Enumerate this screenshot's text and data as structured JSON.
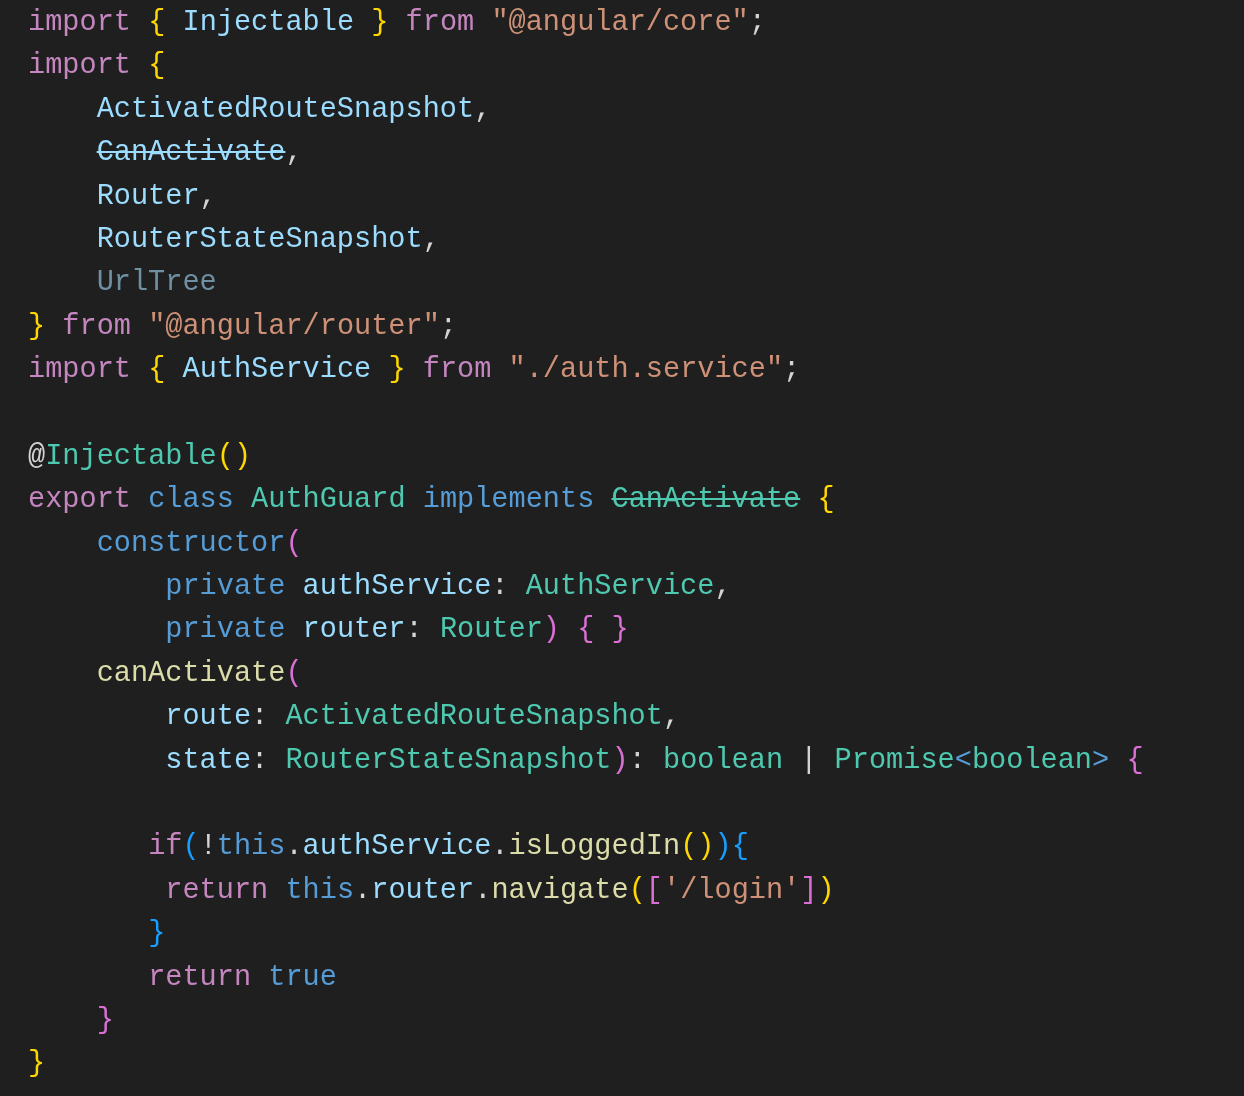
{
  "editor": {
    "lines": [
      {
        "kind": "code",
        "tokens": [
          {
            "text": "import",
            "kind": "keyword"
          },
          {
            "text": " {",
            "kind": "brace1"
          },
          {
            "text": " Injectable ",
            "kind": "variable"
          },
          {
            "text": "}",
            "kind": "brace1"
          },
          {
            "text": " from ",
            "kind": "keyword"
          },
          {
            "text": "\"@angular/core\"",
            "kind": "string"
          },
          {
            "text": ";",
            "kind": "plain"
          }
        ]
      },
      {
        "kind": "code",
        "tokens": [
          {
            "text": "import",
            "kind": "keyword"
          },
          {
            "text": " {",
            "kind": "brace1"
          }
        ]
      },
      {
        "kind": "code",
        "tokens": [
          {
            "text": "    ActivatedRouteSnapshot",
            "kind": "variable"
          },
          {
            "text": ",",
            "kind": "plain"
          }
        ]
      },
      {
        "kind": "code",
        "tokens": [
          {
            "text": "    CanActivate",
            "kind": "deprecated-variable"
          },
          {
            "text": ",",
            "kind": "plain"
          }
        ]
      },
      {
        "kind": "code",
        "tokens": [
          {
            "text": "    Router",
            "kind": "variable"
          },
          {
            "text": ",",
            "kind": "plain"
          }
        ]
      },
      {
        "kind": "code",
        "tokens": [
          {
            "text": "    RouterStateSnapshot",
            "kind": "variable"
          },
          {
            "text": ",",
            "kind": "plain"
          }
        ]
      },
      {
        "kind": "code",
        "tokens": [
          {
            "text": "    UrlTree",
            "kind": "unused"
          }
        ]
      },
      {
        "kind": "code",
        "tokens": [
          {
            "text": "}",
            "kind": "brace1"
          },
          {
            "text": " from ",
            "kind": "keyword"
          },
          {
            "text": "\"@angular/router\"",
            "kind": "string"
          },
          {
            "text": ";",
            "kind": "plain"
          }
        ]
      },
      {
        "kind": "code",
        "tokens": [
          {
            "text": "import",
            "kind": "keyword"
          },
          {
            "text": " {",
            "kind": "brace1"
          },
          {
            "text": " AuthService ",
            "kind": "variable"
          },
          {
            "text": "}",
            "kind": "brace1"
          },
          {
            "text": " from ",
            "kind": "keyword"
          },
          {
            "text": "\"./auth.service\"",
            "kind": "string"
          },
          {
            "text": ";",
            "kind": "plain"
          }
        ]
      },
      {
        "kind": "blank"
      },
      {
        "kind": "code",
        "tokens": [
          {
            "text": "@",
            "kind": "plain"
          },
          {
            "text": "Injectable",
            "kind": "type"
          },
          {
            "text": "()",
            "kind": "brace1"
          }
        ]
      },
      {
        "kind": "code",
        "tokens": [
          {
            "text": "export",
            "kind": "keyword"
          },
          {
            "text": " class",
            "kind": "storage"
          },
          {
            "text": " AuthGuard",
            "kind": "type"
          },
          {
            "text": " implements",
            "kind": "storage"
          },
          {
            "text": " CanActivate",
            "kind": "deprecated-type"
          },
          {
            "text": " {",
            "kind": "brace1"
          }
        ]
      },
      {
        "kind": "code",
        "tokens": [
          {
            "text": "    constructor",
            "kind": "storage"
          },
          {
            "text": "(",
            "kind": "brace2"
          }
        ]
      },
      {
        "kind": "code",
        "tokens": [
          {
            "text": "        private",
            "kind": "storage"
          },
          {
            "text": " authService",
            "kind": "variable"
          },
          {
            "text": ":",
            "kind": "plain"
          },
          {
            "text": " AuthService",
            "kind": "type"
          },
          {
            "text": ",",
            "kind": "plain"
          }
        ]
      },
      {
        "kind": "code",
        "tokens": [
          {
            "text": "        private",
            "kind": "storage"
          },
          {
            "text": " router",
            "kind": "variable"
          },
          {
            "text": ":",
            "kind": "plain"
          },
          {
            "text": " Router",
            "kind": "type"
          },
          {
            "text": ")",
            "kind": "brace2"
          },
          {
            "text": " { }",
            "kind": "brace2"
          }
        ]
      },
      {
        "kind": "code",
        "tokens": [
          {
            "text": "    canActivate",
            "kind": "function"
          },
          {
            "text": "(",
            "kind": "brace2"
          }
        ]
      },
      {
        "kind": "code",
        "tokens": [
          {
            "text": "        route",
            "kind": "variable"
          },
          {
            "text": ":",
            "kind": "plain"
          },
          {
            "text": " ActivatedRouteSnapshot",
            "kind": "type"
          },
          {
            "text": ",",
            "kind": "plain"
          }
        ]
      },
      {
        "kind": "code",
        "tokens": [
          {
            "text": "        state",
            "kind": "variable"
          },
          {
            "text": ":",
            "kind": "plain"
          },
          {
            "text": " RouterStateSnapshot",
            "kind": "type"
          },
          {
            "text": ")",
            "kind": "brace2"
          },
          {
            "text": ":",
            "kind": "plain"
          },
          {
            "text": " boolean",
            "kind": "type"
          },
          {
            "text": " |",
            "kind": "plain"
          },
          {
            "text": " Promise",
            "kind": "type"
          },
          {
            "text": "<",
            "kind": "storage"
          },
          {
            "text": "boolean",
            "kind": "type"
          },
          {
            "text": ">",
            "kind": "storage"
          },
          {
            "text": " {",
            "kind": "brace2"
          }
        ]
      },
      {
        "kind": "blank"
      },
      {
        "kind": "code",
        "tokens": [
          {
            "text": "       if",
            "kind": "keyword"
          },
          {
            "text": "(",
            "kind": "brace3"
          },
          {
            "text": "!",
            "kind": "plain"
          },
          {
            "text": "this",
            "kind": "storage"
          },
          {
            "text": ".",
            "kind": "plain"
          },
          {
            "text": "authService",
            "kind": "variable"
          },
          {
            "text": ".",
            "kind": "plain"
          },
          {
            "text": "isLoggedIn",
            "kind": "function"
          },
          {
            "text": "()",
            "kind": "brace1"
          },
          {
            "text": ")",
            "kind": "brace3"
          },
          {
            "text": "{",
            "kind": "brace3"
          }
        ]
      },
      {
        "kind": "code",
        "tokens": [
          {
            "text": "        return",
            "kind": "keyword"
          },
          {
            "text": " this",
            "kind": "storage"
          },
          {
            "text": ".",
            "kind": "plain"
          },
          {
            "text": "router",
            "kind": "variable"
          },
          {
            "text": ".",
            "kind": "plain"
          },
          {
            "text": "navigate",
            "kind": "function"
          },
          {
            "text": "(",
            "kind": "brace1"
          },
          {
            "text": "[",
            "kind": "brace2"
          },
          {
            "text": "'/login'",
            "kind": "string"
          },
          {
            "text": "]",
            "kind": "brace2"
          },
          {
            "text": ")",
            "kind": "brace1"
          }
        ]
      },
      {
        "kind": "code",
        "tokens": [
          {
            "text": "       }",
            "kind": "brace3"
          }
        ]
      },
      {
        "kind": "code",
        "tokens": [
          {
            "text": "       return",
            "kind": "keyword"
          },
          {
            "text": " true",
            "kind": "storage"
          }
        ]
      },
      {
        "kind": "code",
        "tokens": [
          {
            "text": "    }",
            "kind": "brace2"
          }
        ]
      },
      {
        "kind": "code",
        "tokens": [
          {
            "text": "}",
            "kind": "brace1"
          }
        ]
      }
    ]
  }
}
